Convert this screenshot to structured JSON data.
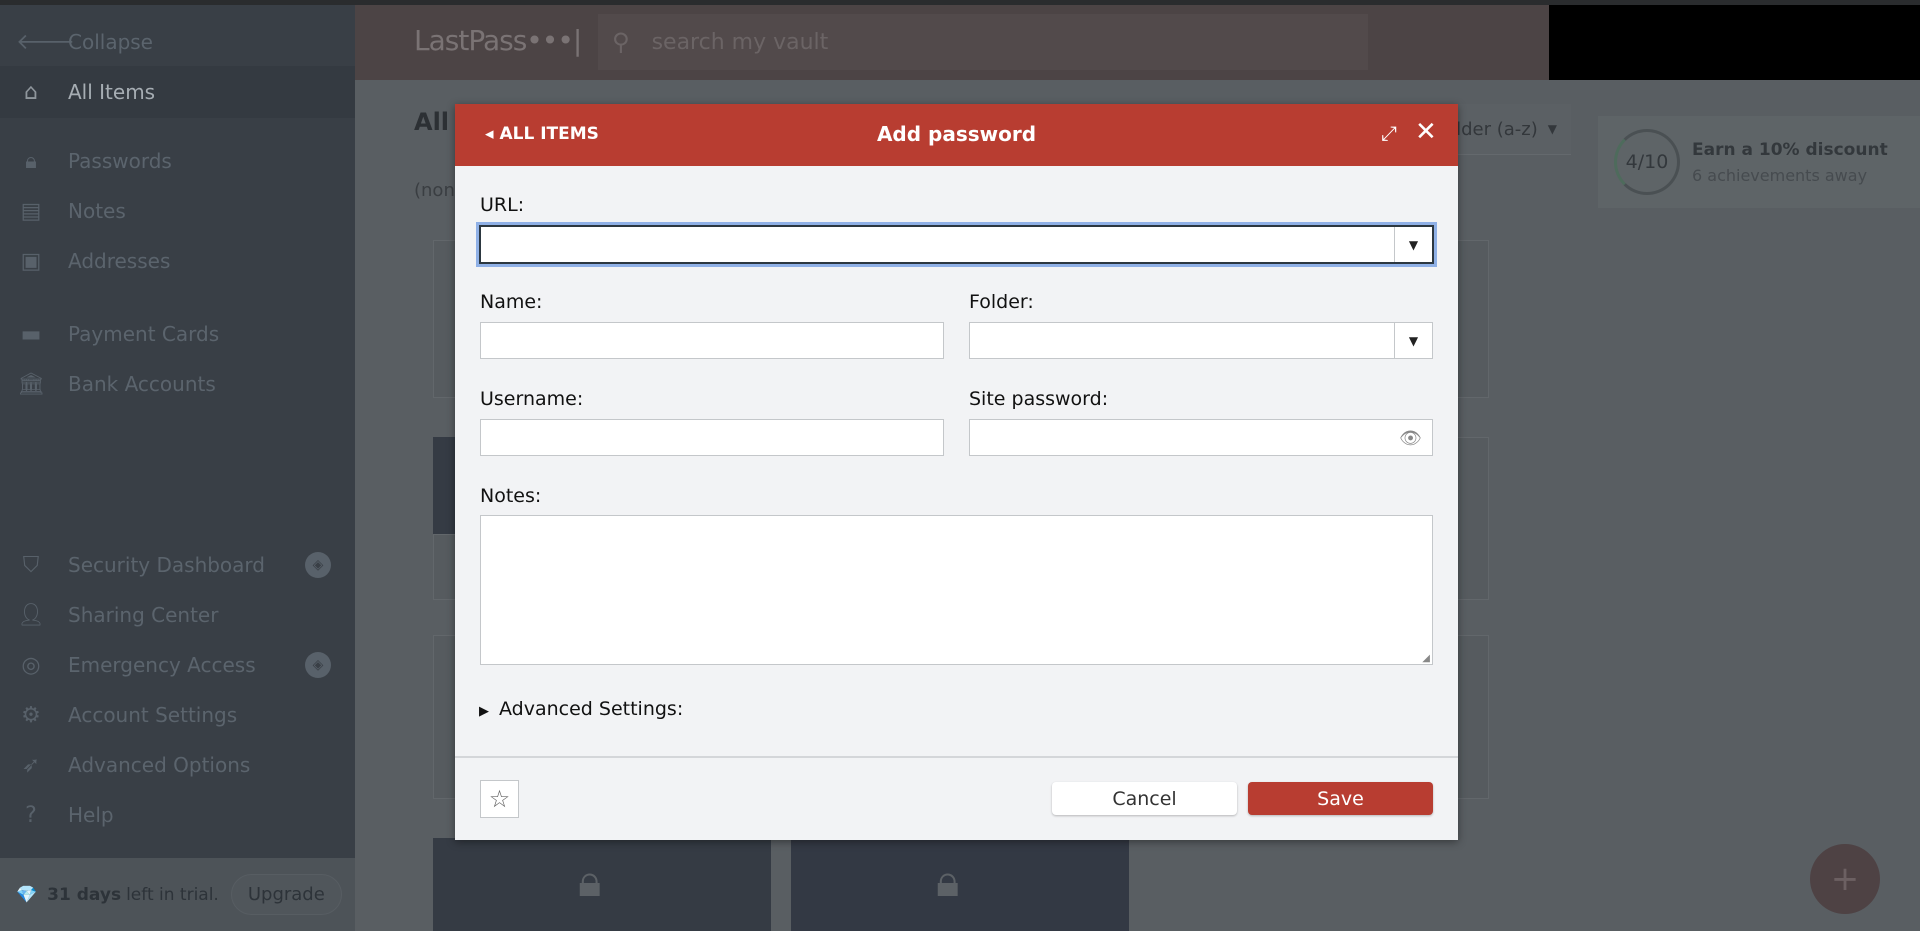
{
  "sidebar": {
    "collapse": "Collapse",
    "items": [
      {
        "label": "All Items",
        "icon": "home-icon",
        "active": true
      },
      {
        "label": "Passwords",
        "icon": "lock-icon"
      },
      {
        "label": "Notes",
        "icon": "note-icon"
      },
      {
        "label": "Addresses",
        "icon": "address-icon"
      },
      {
        "label": "Payment Cards",
        "icon": "credit-card-icon"
      },
      {
        "label": "Bank Accounts",
        "icon": "bank-icon"
      },
      {
        "label": "Security Dashboard",
        "icon": "shield-icon",
        "premium": true
      },
      {
        "label": "Sharing Center",
        "icon": "users-icon"
      },
      {
        "label": "Emergency Access",
        "icon": "lifebuoy-icon",
        "premium": true
      },
      {
        "label": "Account Settings",
        "icon": "gear-icon"
      },
      {
        "label": "Advanced Options",
        "icon": "rocket-icon"
      },
      {
        "label": "Help",
        "icon": "help-icon"
      }
    ],
    "trial": {
      "days": "31 days",
      "text": "left in trial.",
      "upgrade": "Upgrade"
    }
  },
  "header": {
    "logo": "LastPass•••|",
    "search_placeholder": "search my vault"
  },
  "main": {
    "title": "All I",
    "subtitle": "(non",
    "sort": "older (a-z)"
  },
  "achievement": {
    "progress": "4/10",
    "title": "Earn a 10% discount",
    "subtitle": "6 achievements away"
  },
  "fab": "+",
  "modal": {
    "back": "ALL ITEMS",
    "title": "Add password",
    "labels": {
      "url": "URL:",
      "name": "Name:",
      "folder": "Folder:",
      "username": "Username:",
      "password": "Site password:",
      "notes": "Notes:"
    },
    "values": {
      "url": "",
      "name": "",
      "folder": "",
      "username": "",
      "password": "",
      "notes": ""
    },
    "advanced": "Advanced Settings:",
    "cancel": "Cancel",
    "save": "Save"
  },
  "colors": {
    "accent": "#b83d31",
    "sidebar": "#393f46",
    "modal_bg": "#f2f3f5"
  }
}
